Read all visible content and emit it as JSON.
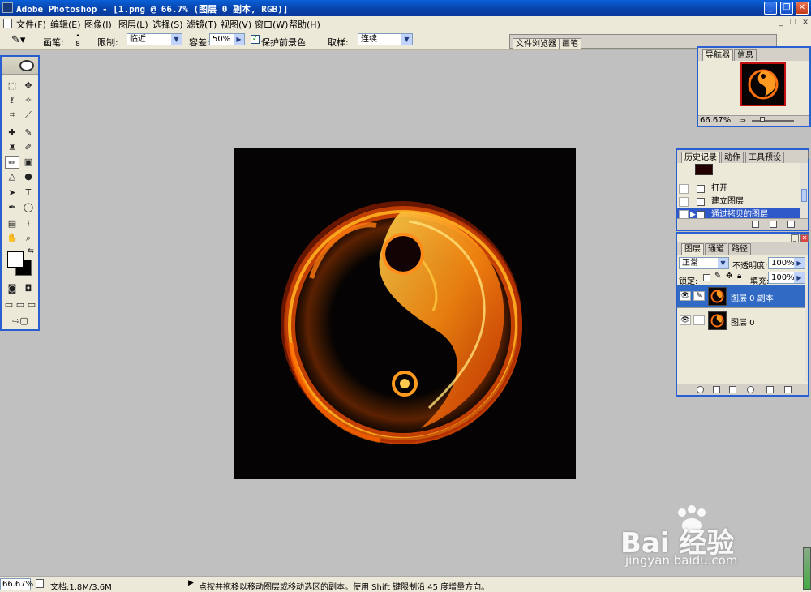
{
  "window": {
    "title": "Adobe Photoshop - [1.png @ 66.7% (图层 0 副本, RGB)]"
  },
  "menu": {
    "items": [
      "文件(F)",
      "编辑(E)",
      "图像(I)",
      "图层(L)",
      "选择(S)",
      "滤镜(T)",
      "视图(V)",
      "窗口(W)",
      "帮助(H)"
    ]
  },
  "options": {
    "brush_label": "画笔:",
    "brush_size": "8",
    "limit_label": "限制:",
    "limit_value": "临近",
    "tolerance_label": "容差:",
    "tolerance_value": "50%",
    "protect_label": "保护前景色",
    "sample_label": "取样:",
    "sample_value": "连续"
  },
  "wells": {
    "tabs": [
      "文件浏览器",
      "画笔"
    ]
  },
  "navigator": {
    "tabs": [
      "导航器",
      "信息"
    ],
    "zoom": "66.67%"
  },
  "history": {
    "tabs": [
      "历史记录",
      "动作",
      "工具预设"
    ],
    "items": [
      {
        "label": "打开"
      },
      {
        "label": "建立图层"
      },
      {
        "label": "通过拷贝的图层"
      }
    ]
  },
  "layers": {
    "tabs": [
      "图层",
      "通道",
      "路径"
    ],
    "blend_mode": "正常",
    "opacity_label": "不透明度:",
    "opacity_value": "100%",
    "lock_label": "锁定:",
    "fill_label": "填充:",
    "fill_value": "100%",
    "items": [
      {
        "name": "图层 0 副本"
      },
      {
        "name": "图层 0"
      }
    ]
  },
  "status": {
    "zoom": "66.67%",
    "doc_info": "文档:1.8M/3.6M",
    "hint": "点按并拖移以移动图层或移动选区的副本。使用 Shift 键限制沿 45 度增量方向。"
  },
  "watermark": {
    "brand": "Bai 经验",
    "url": "jingyan.baidu.com"
  },
  "colors": {
    "title_bar": "#0842a8",
    "panel_border": "#2a5fd0",
    "selection": "#316ac5",
    "workspace": "#c0c0c0"
  }
}
